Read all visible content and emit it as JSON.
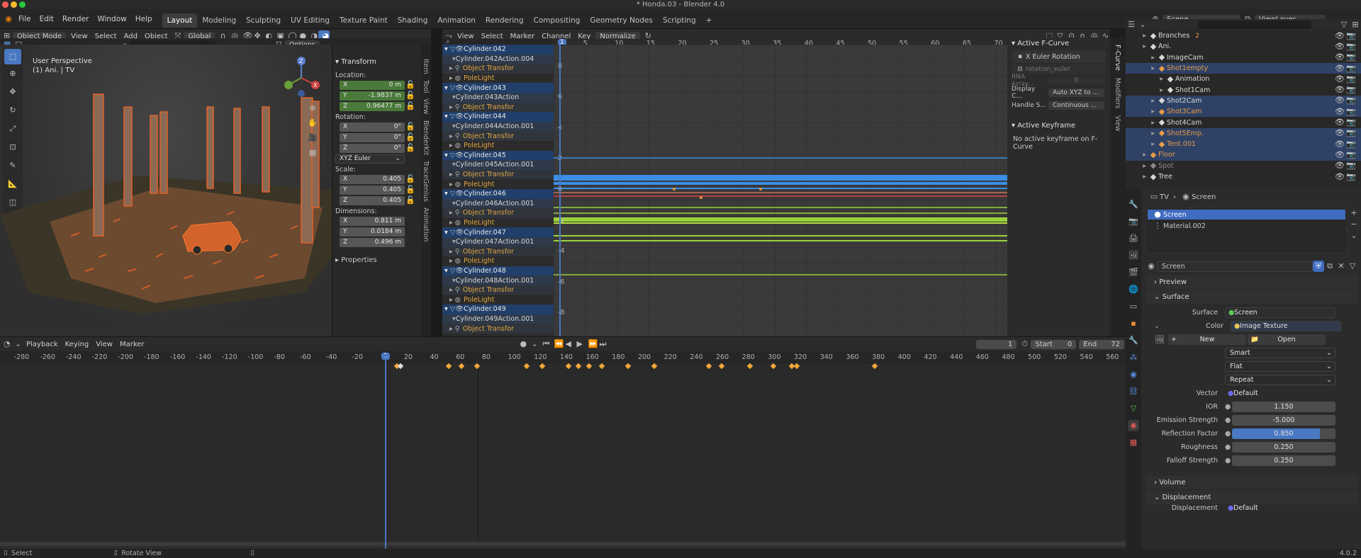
{
  "window": {
    "title": "* Honda.03 - Blender 4.0",
    "mac_dots": [
      "#ff5f57",
      "#febc2e",
      "#28c840"
    ]
  },
  "menu": {
    "items": [
      "File",
      "Edit",
      "Render",
      "Window",
      "Help"
    ],
    "workspaces": [
      "Layout",
      "Modeling",
      "Sculpting",
      "UV Editing",
      "Texture Paint",
      "Shading",
      "Animation",
      "Rendering",
      "Compositing",
      "Geometry Nodes",
      "Scripting",
      "+"
    ],
    "active_workspace": "Layout",
    "scene": "Scene",
    "view_layer": "ViewLayer"
  },
  "viewport_header": {
    "mode": "Object Mode",
    "menus": [
      "View",
      "Select",
      "Add",
      "Object"
    ],
    "orientation": "Global",
    "options": "Options"
  },
  "viewport": {
    "perspective": "User Perspective",
    "context": "(1) Ani. | TV"
  },
  "npanel": {
    "title": "Transform",
    "location_label": "Location:",
    "location": [
      {
        "axis": "X",
        "value": "0 m"
      },
      {
        "axis": "Y",
        "value": "-1.9837 m"
      },
      {
        "axis": "Z",
        "value": "0.96477 m"
      }
    ],
    "rotation_label": "Rotation:",
    "rotation": [
      {
        "axis": "X",
        "value": "0°"
      },
      {
        "axis": "Y",
        "value": "0°"
      },
      {
        "axis": "Z",
        "value": "0°"
      }
    ],
    "rotation_mode": "XYZ Euler",
    "scale_label": "Scale:",
    "scale": [
      {
        "axis": "X",
        "value": "0.405"
      },
      {
        "axis": "Y",
        "value": "0.405"
      },
      {
        "axis": "Z",
        "value": "0.405"
      }
    ],
    "dimensions_label": "Dimensions:",
    "dimensions": [
      {
        "axis": "X",
        "value": "0.811 m"
      },
      {
        "axis": "Y",
        "value": "0.0184 m"
      },
      {
        "axis": "Z",
        "value": "0.496 m"
      }
    ],
    "properties": "Properties",
    "tabs": [
      "Item",
      "Tool",
      "View",
      "BlenderKit",
      "TraceGenius",
      "Animation"
    ]
  },
  "graph_header": {
    "menus": [
      "View",
      "Select",
      "Marker",
      "Channel",
      "Key"
    ],
    "normalize": "Normalize"
  },
  "graph": {
    "frame_ticks": [
      "1",
      "5",
      "10",
      "15",
      "20",
      "25",
      "30",
      "35",
      "40",
      "45",
      "50",
      "55",
      "60",
      "65",
      "70"
    ],
    "value_ticks": [
      "8",
      "6",
      "4",
      "2",
      "0",
      "-2",
      "-4",
      "-6",
      "-8"
    ],
    "current_frame": "1"
  },
  "channels": [
    {
      "type": "obj",
      "label": "Cylinder.042"
    },
    {
      "type": "act",
      "label": "Cylinder.042Action.004"
    },
    {
      "type": "grp",
      "label": "Object Transfor"
    },
    {
      "type": "pl",
      "label": "PoleLight"
    },
    {
      "type": "obj",
      "label": "Cylinder.043"
    },
    {
      "type": "act",
      "label": "Cylinder.043Action"
    },
    {
      "type": "grp",
      "label": "Object Transfor"
    },
    {
      "type": "obj",
      "label": "Cylinder.044"
    },
    {
      "type": "act",
      "label": "Cylinder.044Action.001"
    },
    {
      "type": "grp",
      "label": "Object Transfor"
    },
    {
      "type": "pl",
      "label": "PoleLight"
    },
    {
      "type": "obj",
      "label": "Cylinder.045"
    },
    {
      "type": "act",
      "label": "Cylinder.045Action.001"
    },
    {
      "type": "grp",
      "label": "Object Transfor"
    },
    {
      "type": "pl",
      "label": "PoleLight"
    },
    {
      "type": "obj",
      "label": "Cylinder.046"
    },
    {
      "type": "act",
      "label": "Cylinder.046Action.001"
    },
    {
      "type": "grp",
      "label": "Object Transfor"
    },
    {
      "type": "pl",
      "label": "PoleLight"
    },
    {
      "type": "obj",
      "label": "Cylinder.047"
    },
    {
      "type": "act",
      "label": "Cylinder.047Action.001"
    },
    {
      "type": "grp",
      "label": "Object Transfor"
    },
    {
      "type": "pl",
      "label": "PoleLight"
    },
    {
      "type": "obj",
      "label": "Cylinder.048"
    },
    {
      "type": "act",
      "label": "Cylinder.048Action.001"
    },
    {
      "type": "grp",
      "label": "Object Transfor"
    },
    {
      "type": "pl",
      "label": "PoleLight"
    },
    {
      "type": "obj",
      "label": "Cylinder.049"
    },
    {
      "type": "act",
      "label": "Cylinder.049Action.001"
    },
    {
      "type": "grp",
      "label": "Object Transfor"
    }
  ],
  "fcurve_panel": {
    "active_fcurve": "Active F-Curve",
    "channel_name": "X Euler Rotation",
    "data_path": "rotation_euler",
    "rna_label": "RNA Array...",
    "rna_value": "0",
    "display_label": "Display C...",
    "display_value": "Auto XYZ to ...",
    "handle_label": "Handle S...",
    "handle_value": "Continuous ...",
    "active_keyframe": "Active Keyframe",
    "no_keyframe": "No active keyframe on F-Curve",
    "tabs": [
      "F-Curve",
      "Modifiers",
      "View"
    ]
  },
  "outliner": [
    {
      "label": "Branches",
      "indent": 1,
      "color": "#d8d8d8",
      "badge": "2",
      "sel": false
    },
    {
      "label": "Ani.",
      "indent": 1,
      "color": "#d8d8d8",
      "sel": false
    },
    {
      "label": "ImageCam",
      "indent": 2,
      "color": "#d8d8d8",
      "sel": false
    },
    {
      "label": "Shot1empty",
      "indent": 2,
      "color": "#e89b4a",
      "sel": true
    },
    {
      "label": "Animation",
      "indent": 3,
      "color": "#d8d8d8",
      "sel": false
    },
    {
      "label": "Shot1Cam",
      "indent": 3,
      "color": "#d8d8d8",
      "sel": false
    },
    {
      "label": "Shot2Cam",
      "indent": 2,
      "color": "#d8d8d8",
      "sel": true
    },
    {
      "label": "Shot3Cam",
      "indent": 2,
      "color": "#e89b4a",
      "sel": true
    },
    {
      "label": "Shot4Cam",
      "indent": 2,
      "color": "#d8d8d8",
      "sel": false
    },
    {
      "label": "Shot5Emp.",
      "indent": 2,
      "color": "#e89b4a",
      "sel": true
    },
    {
      "label": "Tent.001",
      "indent": 2,
      "color": "#e89b4a",
      "sel": true
    },
    {
      "label": "Floor",
      "indent": 1,
      "color": "#e89b4a",
      "sel": true
    },
    {
      "label": "Spot",
      "indent": 1,
      "color": "#8a8a8a",
      "sel": false
    },
    {
      "label": "Tree",
      "indent": 1,
      "color": "#d8d8d8",
      "sel": false
    }
  ],
  "properties": {
    "breadcrumb": [
      "TV",
      "Screen"
    ],
    "slots": [
      "Screen",
      "Material.002"
    ],
    "material_name": "Screen",
    "sections": {
      "preview": "Preview",
      "surface": "Surface",
      "volume": "Volume",
      "displacement": "Displacement"
    },
    "surface_label": "Surface",
    "surface_value": "Screen",
    "color_label": "Color",
    "color_value": "Image Texture",
    "new_btn": "New",
    "open_btn": "Open",
    "interp": "Smart",
    "proj": "Flat",
    "ext": "Repeat",
    "vector_label": "Vector",
    "vector_value": "Default",
    "ior_label": "IOR",
    "ior": "1.150",
    "emission_label": "Emission Strength",
    "emission": "-5.000",
    "reflection_label": "Reflection Factor",
    "reflection": "0.850",
    "reflection_fill": 0.85,
    "roughness_label": "Roughness",
    "roughness": "0.250",
    "falloff_label": "Falloff Strength",
    "falloff": "0.250",
    "displacement_label": "Displacement",
    "displacement_value": "Default"
  },
  "timeline": {
    "menus": [
      "Playback",
      "Keying",
      "View",
      "Marker"
    ],
    "current": "1",
    "start_label": "Start",
    "start": "0",
    "end_label": "End",
    "end": "72",
    "ticks": [
      "-280",
      "-260",
      "-240",
      "-220",
      "-200",
      "-180",
      "-160",
      "-140",
      "-120",
      "-100",
      "-80",
      "-60",
      "-40",
      "-20",
      "1",
      "20",
      "40",
      "60",
      "80",
      "100",
      "120",
      "140",
      "160",
      "180",
      "200",
      "220",
      "240",
      "260",
      "280",
      "300",
      "320",
      "340",
      "360",
      "380",
      "400",
      "420",
      "440",
      "460",
      "480",
      "500",
      "520",
      "540",
      "560"
    ],
    "keyframes": [
      10,
      50,
      60,
      72,
      110,
      122,
      142,
      150,
      158,
      168,
      188,
      208,
      250,
      260,
      282,
      300,
      314,
      318,
      378
    ]
  },
  "status": {
    "select": "Select",
    "rotate": "Rotate View",
    "version": "4.0.2"
  }
}
